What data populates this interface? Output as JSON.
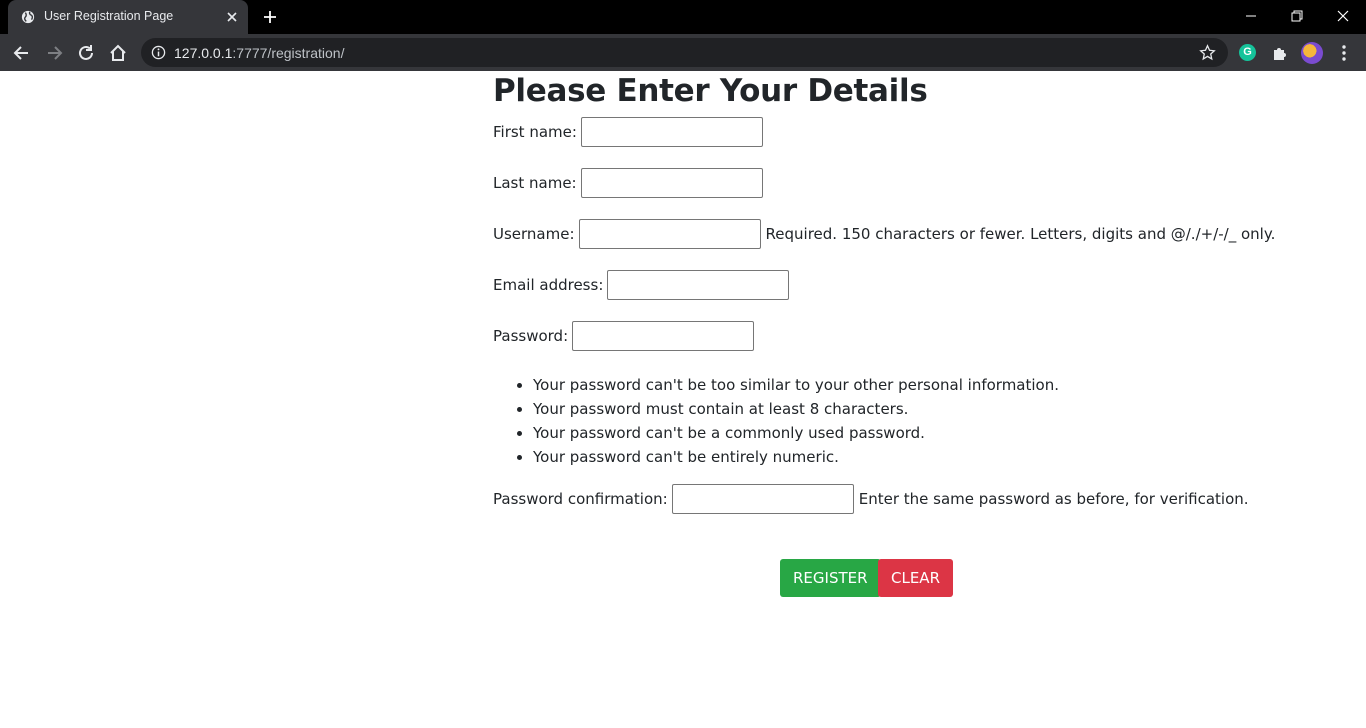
{
  "browser": {
    "tab_title": "User Registration Page",
    "url_host": "127.0.0.1",
    "url_rest": ":7777/registration/"
  },
  "form": {
    "heading": "Please Enter Your Details",
    "first_name_label": "First name:",
    "last_name_label": "Last name:",
    "username_label": "Username:",
    "username_help": "Required. 150 characters or fewer. Letters, digits and @/./+/-/_ only.",
    "email_label": "Email address:",
    "password_label": "Password:",
    "password_rules": [
      "Your password can't be too similar to your other personal information.",
      "Your password must contain at least 8 characters.",
      "Your password can't be a commonly used password.",
      "Your password can't be entirely numeric."
    ],
    "password_confirm_label": "Password confirmation:",
    "password_confirm_help": "Enter the same password as before, for verification.",
    "register_button": "REGISTER",
    "clear_button": "CLEAR"
  },
  "colors": {
    "register": "#28a745",
    "clear": "#dc3545"
  }
}
